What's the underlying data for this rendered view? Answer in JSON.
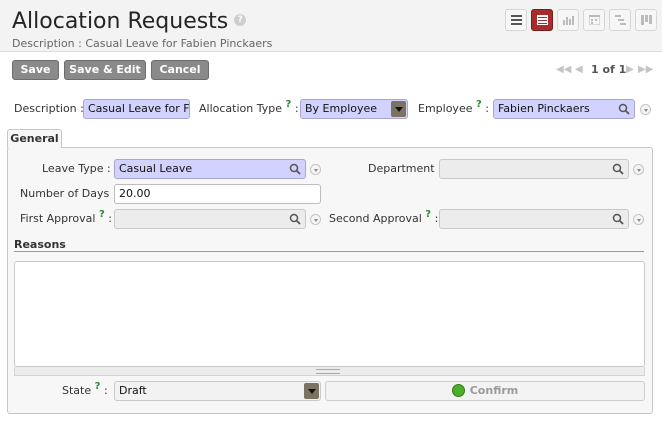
{
  "header": {
    "title": "Allocation Requests",
    "help_icon": "?",
    "subtitle": "Description : Casual Leave for Fabien Pinckaers",
    "views": [
      {
        "name": "list-view",
        "active": false
      },
      {
        "name": "form-view",
        "active": true
      },
      {
        "name": "graph-view",
        "active": false
      },
      {
        "name": "calendar-view",
        "active": false
      },
      {
        "name": "gantt-view",
        "active": false
      },
      {
        "name": "kanban-view",
        "active": false
      }
    ]
  },
  "toolbar": {
    "save_label": "Save",
    "save_edit_label": "Save & Edit",
    "cancel_label": "Cancel"
  },
  "pager": {
    "text": "1 of 1"
  },
  "top_fields": {
    "description_label": "Description :",
    "description_value": "Casual Leave for Fabien Pinckaers",
    "allocation_type_label": "Allocation Type",
    "allocation_type_value": "By Employee",
    "employee_label": "Employee",
    "employee_value": "Fabien Pinckaers",
    "colon": ":",
    "help_mark": "?"
  },
  "tabs": [
    {
      "label": "General",
      "active": true
    }
  ],
  "general": {
    "leave_type_label": "Leave Type :",
    "leave_type_value": "Casual Leave",
    "department_label": "Department :",
    "department_value": "",
    "days_label": "Number of Days :",
    "days_value": "20.00",
    "first_approval_label": "First Approval",
    "first_approval_value": "",
    "second_approval_label": "Second Approval",
    "second_approval_value": "",
    "reasons_label": "Reasons",
    "reasons_value": "",
    "state_label": "State",
    "state_value": "Draft",
    "confirm_label": "Confirm"
  },
  "colors": {
    "required_bg": "#d2d2ff",
    "button_bg": "#8a8a8a",
    "active_view": "#a82c2c",
    "confirm_dot": "#4caf2a"
  }
}
